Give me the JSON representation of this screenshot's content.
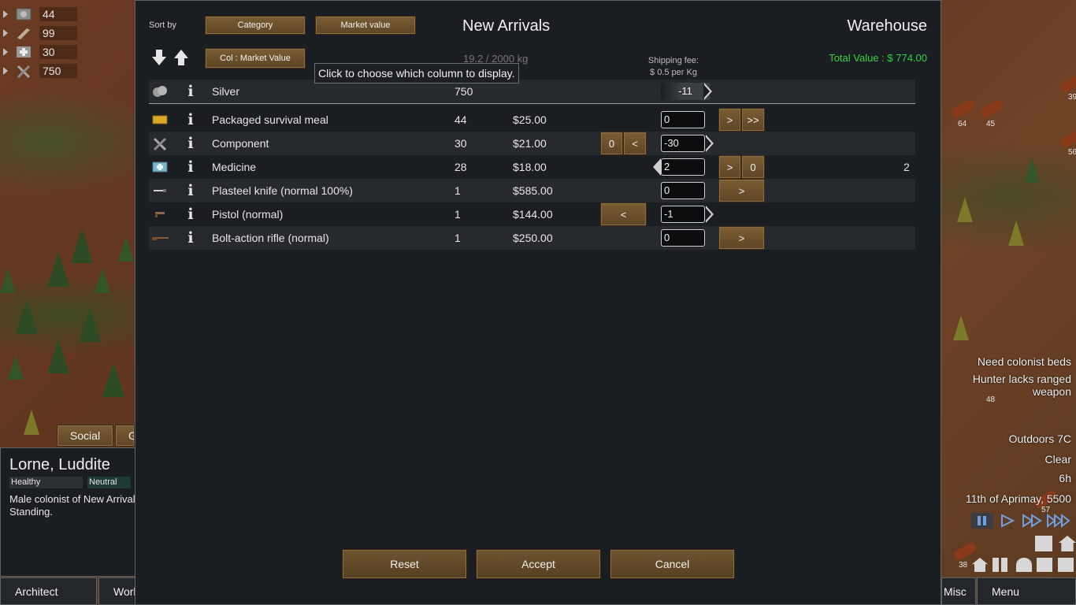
{
  "resources": [
    {
      "icon": "silver-icon",
      "count": "44"
    },
    {
      "icon": "wood-icon",
      "count": "99"
    },
    {
      "icon": "medicine-icon",
      "count": "30"
    },
    {
      "icon": "component-icon",
      "count": "750"
    }
  ],
  "dialog": {
    "sort_by_label": "Sort by",
    "sort_category": "Category",
    "sort_market_value": "Market value",
    "column_button": "Col : Market Value",
    "title_left": "New Arrivals",
    "title_right": "Warehouse",
    "mass": "19.2 / 2000 kg",
    "shipping_fee_label": "Shipping fee:",
    "shipping_fee_value": "$ 0.5 per Kg",
    "total_value": "Total Value : $ 774.00",
    "tooltip": "Click to choose which column to display."
  },
  "silver_row": {
    "name": "Silver",
    "count": "750",
    "qty": "-11"
  },
  "items": [
    {
      "name": "Packaged survival meal",
      "count": "44",
      "price": "$25.00",
      "qty": "0",
      "right_count": ""
    },
    {
      "name": "Component",
      "count": "30",
      "price": "$21.00",
      "qty": "-30",
      "right_count": ""
    },
    {
      "name": "Medicine",
      "count": "28",
      "price": "$18.00",
      "qty": "2",
      "right_count": "2"
    },
    {
      "name": "Plasteel knife (normal 100%)",
      "count": "1",
      "price": "$585.00",
      "qty": "0",
      "right_count": ""
    },
    {
      "name": "Pistol (normal)",
      "count": "1",
      "price": "$144.00",
      "qty": "-1",
      "right_count": ""
    },
    {
      "name": "Bolt-action rifle (normal)",
      "count": "1",
      "price": "$250.00",
      "qty": "0",
      "right_count": ""
    }
  ],
  "row_buttons": {
    "zero": "0",
    "less": "<",
    "more": ">",
    "max_more": ">>"
  },
  "footer": {
    "reset": "Reset",
    "accept": "Accept",
    "cancel": "Cancel"
  },
  "colonist": {
    "name": "Lorne, Luddite",
    "health": "Healthy",
    "mood": "Neutral",
    "description": "Male colonist of New Arrivals",
    "status": "Standing."
  },
  "tabs": {
    "social": "Social",
    "gear": "Gear"
  },
  "bottom_bar": {
    "architect": "Architect",
    "work": "Work",
    "misc": "Misc",
    "menu": "Menu"
  },
  "alerts": [
    "Need colonist beds",
    "Hunter lacks ranged weapon"
  ],
  "weather": {
    "temperature": "Outdoors 7C",
    "condition": "Clear",
    "time": "6h",
    "date": "11th of Aprimay, 5500"
  },
  "map_counts": {
    "a": "64",
    "b": "45",
    "c": "48",
    "d": "57",
    "e": "38",
    "f": "39",
    "g": "56"
  }
}
